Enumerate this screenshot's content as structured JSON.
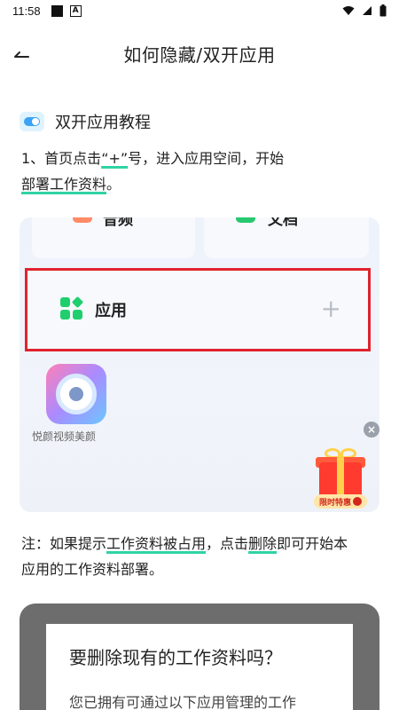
{
  "status_bar": {
    "time": "11:58",
    "icons": [
      "square-icon",
      "a-badge-icon",
      "wifi-icon",
      "signal-icon",
      "battery-icon"
    ]
  },
  "header": {
    "back_icon": "back-arrow-icon",
    "title": "如何隐藏/双开应用"
  },
  "section": {
    "icon": "toggle-icon",
    "title": "双开应用教程"
  },
  "step1": {
    "p1": "1、首页点击",
    "p2": "“+”",
    "p3": "号，进入应用空间，开始",
    "p4": "部署工作资料",
    "p5": "。"
  },
  "screenshot": {
    "tile_left_label": "音频",
    "tile_right_label": "文档",
    "app_label": "应用",
    "app_icon": "grid-icon",
    "plus_icon": "plus-icon",
    "app_name": "悦颜视频美颜",
    "close_icon": "close-icon",
    "gift_icon": "gift-icon",
    "gift_tag": "限时特惠",
    "highlight_color": "#e0232e"
  },
  "note": {
    "n1": "注：如果提示",
    "n2": "工作资料被占用",
    "n3": "，点击",
    "n4": "删除",
    "n5": "即可开始本",
    "n6": "应用的工作资料部署。"
  },
  "dialog": {
    "title": "要删除现有的工作资料吗？",
    "body": "您已拥有可通过以下应用管理的工作"
  },
  "colors": {
    "accent_underline": "#2fd3a4",
    "toggle_blue": "#3aa3f5"
  }
}
